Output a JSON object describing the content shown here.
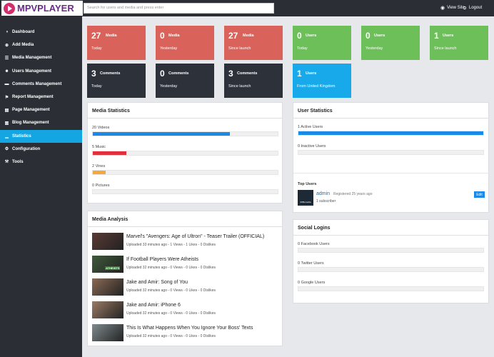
{
  "header": {
    "logo": "MPVPLAYER",
    "search_placeholder": "Search for users and media and press enter",
    "view_site": "View Site",
    "logout": "Logout"
  },
  "sidebar": {
    "items": [
      {
        "label": "Dashboard",
        "icon": "dashboard-icon"
      },
      {
        "label": "Add Media",
        "icon": "plus-icon"
      },
      {
        "label": "Media Management",
        "icon": "list-icon"
      },
      {
        "label": "Users Management",
        "icon": "users-icon"
      },
      {
        "label": "Comments Management",
        "icon": "comment-icon"
      },
      {
        "label": "Report Management",
        "icon": "flag-icon"
      },
      {
        "label": "Page Management",
        "icon": "file-icon"
      },
      {
        "label": "Blog Management",
        "icon": "book-icon"
      },
      {
        "label": "Statistics",
        "icon": "bar-chart-icon"
      },
      {
        "label": "Configuration",
        "icon": "gear-icon"
      },
      {
        "label": "Tools",
        "icon": "wrench-icon"
      }
    ],
    "active_index": 8
  },
  "tiles": [
    {
      "num": "27",
      "label": "Media",
      "sub": "Today",
      "color": "#d9635a"
    },
    {
      "num": "0",
      "label": "Media",
      "sub": "Yesterday",
      "color": "#d9635a"
    },
    {
      "num": "27",
      "label": "Media",
      "sub": "Since launch",
      "color": "#d9635a"
    },
    {
      "num": "0",
      "label": "Users",
      "sub": "Today",
      "color": "#6dbf5a"
    },
    {
      "num": "0",
      "label": "Users",
      "sub": "Yesterday",
      "color": "#6dbf5a"
    },
    {
      "num": "1",
      "label": "Users",
      "sub": "Since launch",
      "color": "#6dbf5a"
    },
    {
      "num": "3",
      "label": "Comments",
      "sub": "Today",
      "color": "#2c313a"
    },
    {
      "num": "0",
      "label": "Comments",
      "sub": "Yesterday",
      "color": "#2c313a"
    },
    {
      "num": "3",
      "label": "Comments",
      "sub": "Since launch",
      "color": "#2c313a"
    },
    {
      "num": "1",
      "label": "Users",
      "sub": "From United Kingdom",
      "color": "#17a9ea"
    }
  ],
  "media_stats": {
    "title": "Media Statistics",
    "rows": [
      {
        "label": "20 Videos",
        "fraction": 0.74,
        "color": "#1a8ae6"
      },
      {
        "label": "5 Music",
        "fraction": 0.18,
        "color": "#e0303c"
      },
      {
        "label": "2 Vines",
        "fraction": 0.07,
        "color": "#f5a93c"
      },
      {
        "label": "0 Pictures",
        "fraction": 0,
        "color": "#1a8ae6"
      }
    ]
  },
  "user_stats": {
    "title": "User Statistics",
    "rows": [
      {
        "label": "1 Active Users",
        "fraction": 1.0,
        "color": "#1a8ae6"
      },
      {
        "label": "0 Inactive Users",
        "fraction": 0,
        "color": "#1a8ae6"
      }
    ],
    "top_users_title": "Top Users",
    "top_user": {
      "name": "admin",
      "registered": "Registered 25 years ago",
      "subscribers": "1 subscriber",
      "avatar_text": "IDBLmedia",
      "edit": "Edit"
    }
  },
  "media_analysis": {
    "title": "Media Analysis",
    "videos": [
      {
        "title": "Marvel's \"Avengers: Age of Ultron\" - Teaser Trailer (OFFICIAL)",
        "meta": "Uploaded 33 minutes ago - 1 Views - 1 Likes - 0 Dislikes",
        "thumb_color": "#5a3a34"
      },
      {
        "title": "If Football Players Were Atheists",
        "meta": "Uploaded 32 minutes ago - 0 Views - 0 Likes - 0 Dislikes",
        "thumb_color": "#3f5a3a",
        "thumb_text": "ATHEISTS"
      },
      {
        "title": "Jake and Amir: Song of You",
        "meta": "Uploaded 32 minutes ago - 0 Views - 0 Likes - 0 Dislikes",
        "thumb_color": "#8a6a55"
      },
      {
        "title": "Jake and Amir: iPhone 6",
        "meta": "Uploaded 32 minutes ago - 0 Views - 0 Likes - 0 Dislikes",
        "thumb_color": "#9a7b64"
      },
      {
        "title": "This Is What Happens When You Ignore Your Boss' Texts",
        "meta": "Uploaded 32 minutes ago - 0 Views - 0 Likes - 0 Dislikes",
        "thumb_color": "#7f8a8e"
      }
    ]
  },
  "social_logins": {
    "title": "Social Logins",
    "rows": [
      {
        "label": "0 Facebook Users",
        "fraction": 0
      },
      {
        "label": "0 Twitter Users",
        "fraction": 0
      },
      {
        "label": "0 Google Users",
        "fraction": 0
      }
    ]
  }
}
